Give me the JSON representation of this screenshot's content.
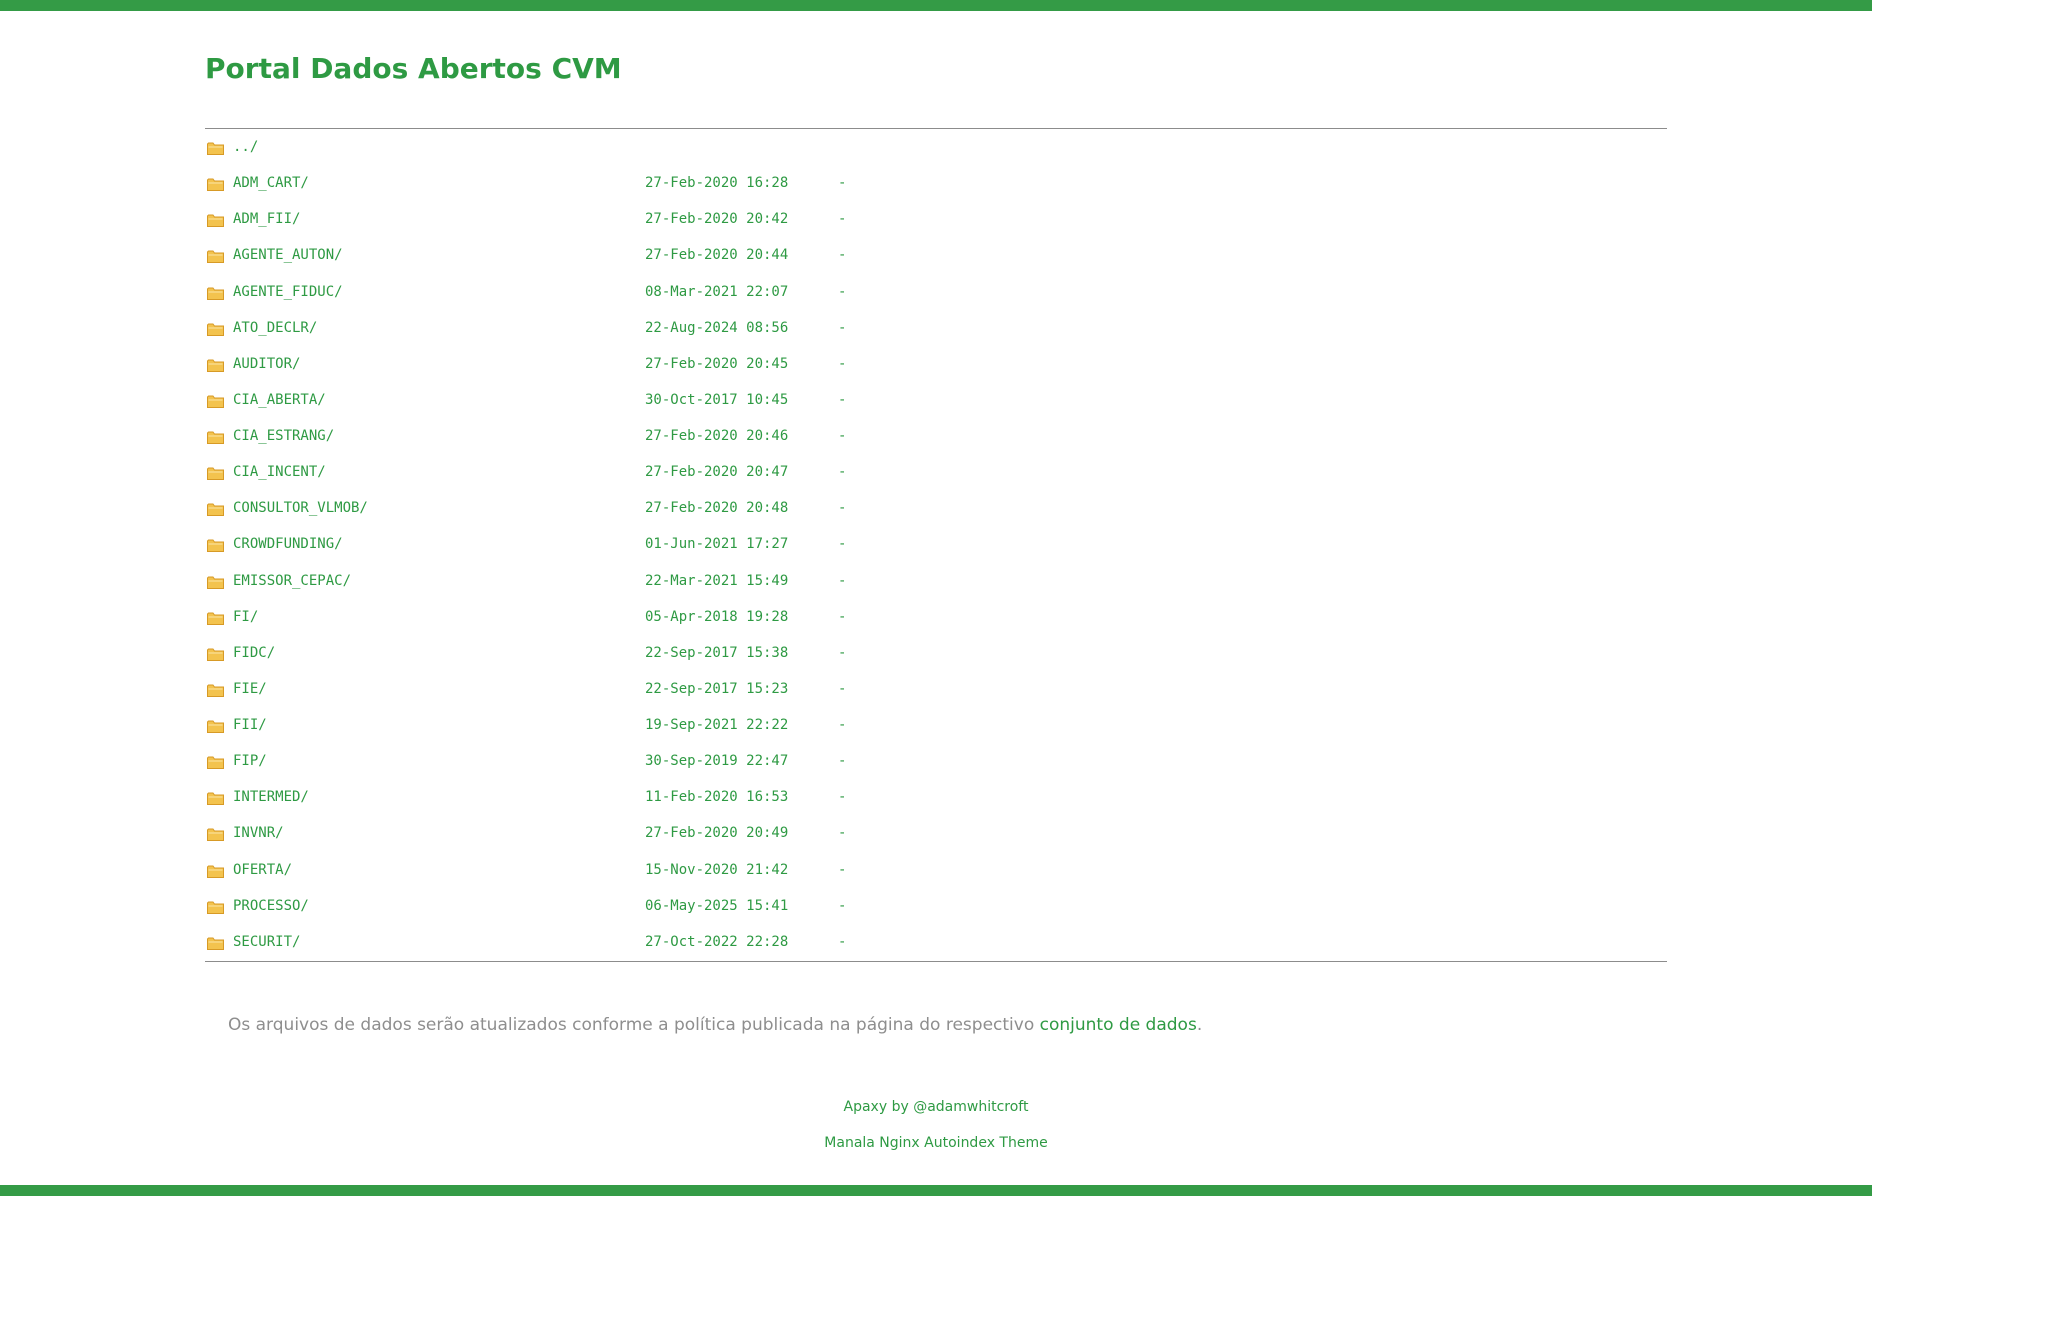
{
  "header": {
    "title": "Portal Dados Abertos CVM"
  },
  "colors": {
    "brand_green": "#349b46",
    "link_green": "#2e9a43",
    "muted_text": "#8e8e8e",
    "folder_icon": "#f3c34e"
  },
  "listing": {
    "parent": {
      "name": "../",
      "icon": "folder-icon"
    },
    "rows": [
      {
        "name": "ADM_CART/",
        "date": "27-Feb-2020 16:28",
        "size": "-",
        "icon": "folder-icon"
      },
      {
        "name": "ADM_FII/",
        "date": "27-Feb-2020 20:42",
        "size": "-",
        "icon": "folder-icon"
      },
      {
        "name": "AGENTE_AUTON/",
        "date": "27-Feb-2020 20:44",
        "size": "-",
        "icon": "folder-icon"
      },
      {
        "name": "AGENTE_FIDUC/",
        "date": "08-Mar-2021 22:07",
        "size": "-",
        "icon": "folder-icon"
      },
      {
        "name": "ATO_DECLR/",
        "date": "22-Aug-2024 08:56",
        "size": "-",
        "icon": "folder-icon"
      },
      {
        "name": "AUDITOR/",
        "date": "27-Feb-2020 20:45",
        "size": "-",
        "icon": "folder-icon"
      },
      {
        "name": "CIA_ABERTA/",
        "date": "30-Oct-2017 10:45",
        "size": "-",
        "icon": "folder-icon"
      },
      {
        "name": "CIA_ESTRANG/",
        "date": "27-Feb-2020 20:46",
        "size": "-",
        "icon": "folder-icon"
      },
      {
        "name": "CIA_INCENT/",
        "date": "27-Feb-2020 20:47",
        "size": "-",
        "icon": "folder-icon"
      },
      {
        "name": "CONSULTOR_VLMOB/",
        "date": "27-Feb-2020 20:48",
        "size": "-",
        "icon": "folder-icon"
      },
      {
        "name": "CROWDFUNDING/",
        "date": "01-Jun-2021 17:27",
        "size": "-",
        "icon": "folder-icon"
      },
      {
        "name": "EMISSOR_CEPAC/",
        "date": "22-Mar-2021 15:49",
        "size": "-",
        "icon": "folder-icon"
      },
      {
        "name": "FI/",
        "date": "05-Apr-2018 19:28",
        "size": "-",
        "icon": "folder-icon"
      },
      {
        "name": "FIDC/",
        "date": "22-Sep-2017 15:38",
        "size": "-",
        "icon": "folder-icon"
      },
      {
        "name": "FIE/",
        "date": "22-Sep-2017 15:23",
        "size": "-",
        "icon": "folder-icon"
      },
      {
        "name": "FII/",
        "date": "19-Sep-2021 22:22",
        "size": "-",
        "icon": "folder-icon"
      },
      {
        "name": "FIP/",
        "date": "30-Sep-2019 22:47",
        "size": "-",
        "icon": "folder-icon"
      },
      {
        "name": "INTERMED/",
        "date": "11-Feb-2020 16:53",
        "size": "-",
        "icon": "folder-icon"
      },
      {
        "name": "INVNR/",
        "date": "27-Feb-2020 20:49",
        "size": "-",
        "icon": "folder-icon"
      },
      {
        "name": "OFERTA/",
        "date": "15-Nov-2020 21:42",
        "size": "-",
        "icon": "folder-icon"
      },
      {
        "name": "PROCESSO/",
        "date": "06-May-2025 15:41",
        "size": "-",
        "icon": "folder-icon"
      },
      {
        "name": "SECURIT/",
        "date": "27-Oct-2022 22:28",
        "size": "-",
        "icon": "folder-icon"
      }
    ]
  },
  "notice": {
    "text": "Os arquivos de dados serão atualizados conforme a política publicada na página do respectivo ",
    "link_label": "conjunto de dados",
    "suffix": "."
  },
  "footer": {
    "credit_1": "Apaxy by @adamwhitcroft",
    "credit_2": "Manala Nginx Autoindex Theme"
  }
}
